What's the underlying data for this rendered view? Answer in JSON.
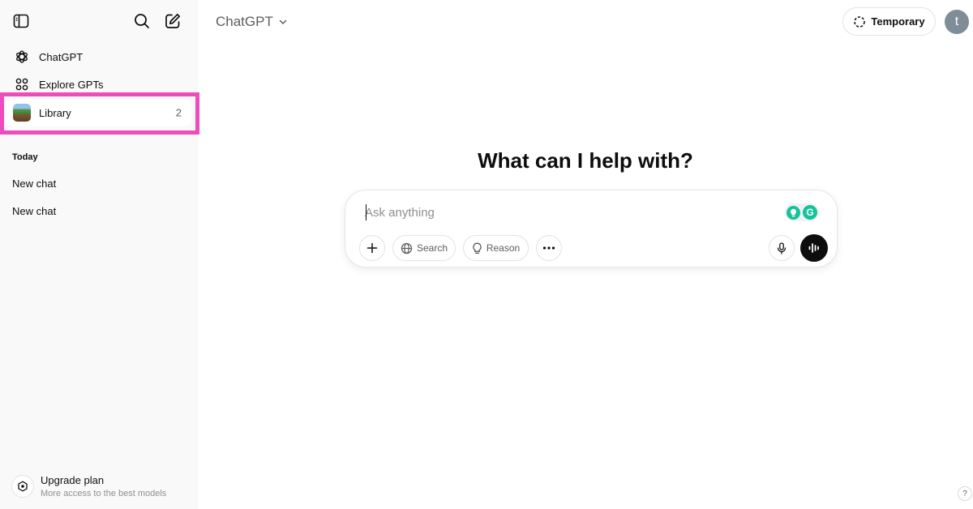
{
  "sidebar": {
    "nav": [
      {
        "label": "ChatGPT",
        "icon": "openai-logo-icon"
      },
      {
        "label": "Explore GPTs",
        "icon": "grid-icon"
      },
      {
        "label": "Library",
        "icon": "library-thumbnail",
        "count": "2"
      }
    ],
    "section_today": "Today",
    "chats": [
      "New chat",
      "New chat"
    ],
    "upgrade": {
      "title": "Upgrade plan",
      "subtitle": "More access to the best models"
    }
  },
  "header": {
    "model_name": "ChatGPT",
    "temporary_label": "Temporary",
    "avatar_letter": "t"
  },
  "main": {
    "headline": "What can I help with?",
    "composer": {
      "placeholder": "Ask anything",
      "search_label": "Search",
      "reason_label": "Reason"
    }
  },
  "help_label": "?",
  "colors": {
    "sidebar_bg": "#f9f9f9",
    "highlight": "#ec4cbc",
    "grammarly": "#15c39a",
    "avatar": "#7f8d99"
  }
}
